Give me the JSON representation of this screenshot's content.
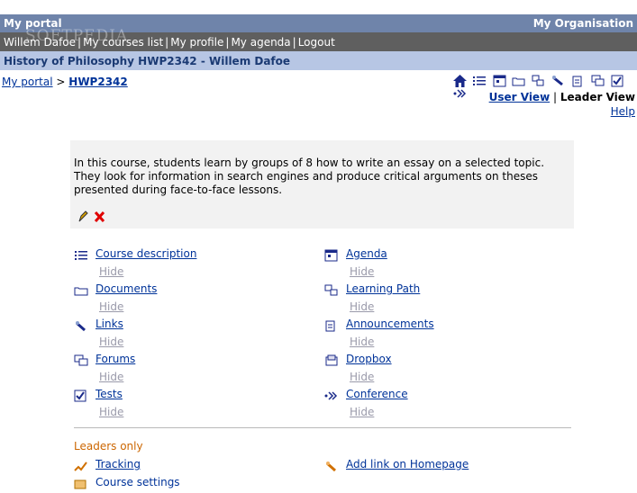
{
  "header": {
    "title": "My portal",
    "organisation": "My Organisation"
  },
  "nav": {
    "user": "Willem Dafoe",
    "items": [
      "My courses list",
      "My profile",
      "My agenda",
      "Logout"
    ],
    "watermark": "SOFTPEDIA"
  },
  "course_bar": {
    "title": "History of Philosophy HWP2342 - Willem Dafoe"
  },
  "breadcrumb": {
    "root": "My portal",
    "separator": ">",
    "current": "HWP2342"
  },
  "views": {
    "user_view": "User View",
    "separator": "|",
    "leader_view": "Leader View",
    "help": "Help"
  },
  "course": {
    "description": "In this course, students learn by groups of 8 how to write an essay on a selected topic. They look for information in search engines and produce critical arguments on theses presented during face-to-face lessons."
  },
  "tools_left": [
    {
      "label": "Course description",
      "hide": "Hide",
      "icon": "list-icon"
    },
    {
      "label": "Documents",
      "hide": "Hide",
      "icon": "folder-icon"
    },
    {
      "label": "Links",
      "hide": "Hide",
      "icon": "link-icon"
    },
    {
      "label": "Forums",
      "hide": "Hide",
      "icon": "forum-icon"
    },
    {
      "label": "Tests",
      "hide": "Hide",
      "icon": "checkbox-icon"
    }
  ],
  "tools_right": [
    {
      "label": "Agenda",
      "hide": "Hide",
      "icon": "calendar-icon"
    },
    {
      "label": "Learning Path",
      "hide": "Hide",
      "icon": "learning-path-icon"
    },
    {
      "label": "Announcements",
      "hide": "Hide",
      "icon": "announcement-icon"
    },
    {
      "label": "Dropbox",
      "hide": "Hide",
      "icon": "dropbox-icon"
    },
    {
      "label": "Conference",
      "hide": "Hide",
      "icon": "conference-icon"
    }
  ],
  "leaders": {
    "heading": "Leaders only",
    "tracking": "Tracking",
    "course_settings": "Course settings",
    "add_link": "Add link on Homepage"
  }
}
